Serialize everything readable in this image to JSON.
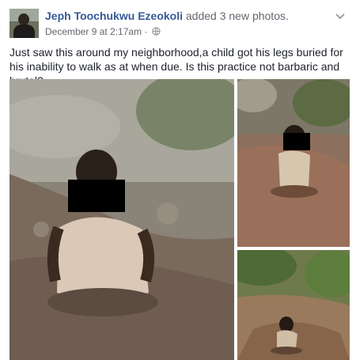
{
  "post": {
    "author": "Jeph Toochukwu Ezeokoli",
    "action": "added 3 new photos.",
    "timestamp": "December 9 at 2:17am",
    "separator": " · ",
    "body": "Just saw this around my neighborhood,a child got his legs buried for his inability to walk as at when due. Is this practice not barbaric and brutal?"
  },
  "icons": {
    "privacy": "globe-icon",
    "menu": "chevron-down-icon"
  },
  "colors": {
    "link": "#365899",
    "meta": "#616770",
    "text": "#1d2129"
  }
}
